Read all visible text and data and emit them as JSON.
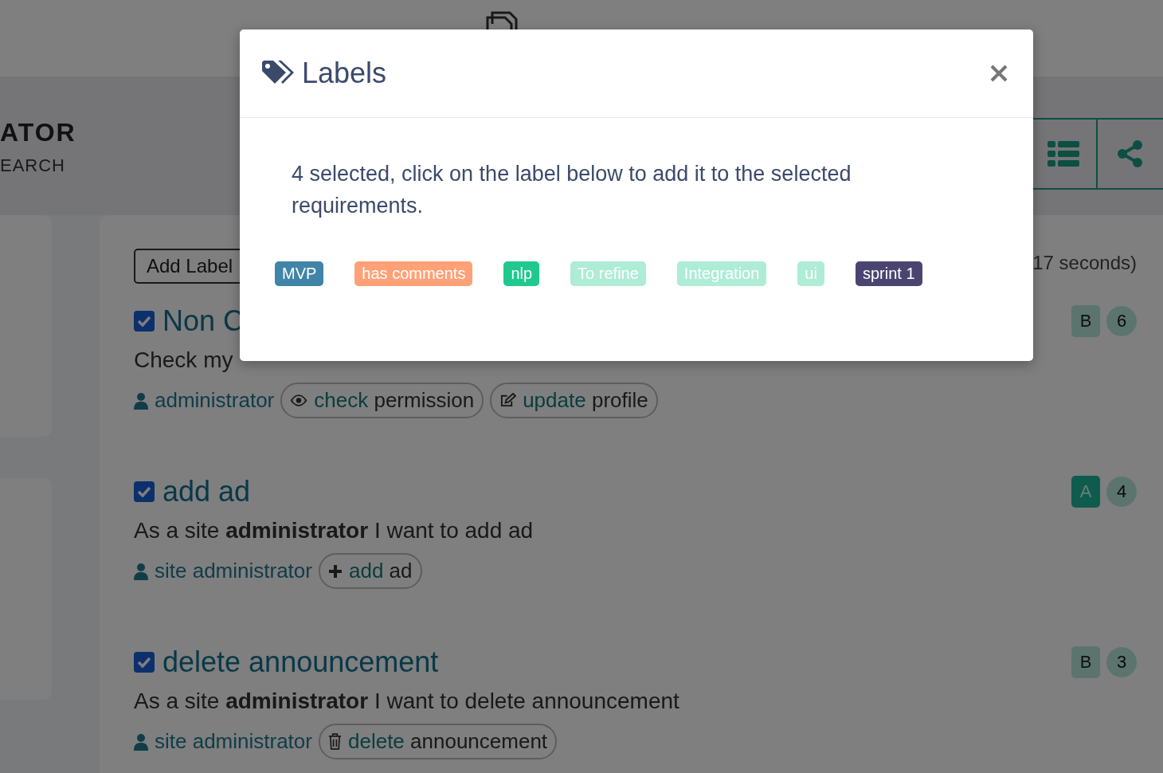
{
  "project": {
    "title": "ATOR",
    "subtitle": "EARCH"
  },
  "toolbar": {
    "add_label": "Add Label",
    "timing": "17 seconds)"
  },
  "requirements": [
    {
      "title": "Non C",
      "checked": true,
      "description": "Check my",
      "actor": "administrator",
      "grade": "B",
      "count": "6",
      "actions": [
        {
          "kind": "view",
          "verb": "check",
          "object": "permission"
        },
        {
          "kind": "edit",
          "verb": "update",
          "object": "profile"
        }
      ]
    },
    {
      "title": "add ad",
      "checked": true,
      "description": "As a site **administrator** I want to add ad",
      "actor": "site administrator",
      "grade": "A",
      "count": "4",
      "actions": [
        {
          "kind": "add",
          "verb": "add",
          "object": "ad"
        }
      ]
    },
    {
      "title": "delete announcement",
      "checked": true,
      "description": "As a site **administrator** I want to delete announcement",
      "actor": "site administrator",
      "grade": "B",
      "count": "3",
      "actions": [
        {
          "kind": "delete",
          "verb": "delete",
          "object": "announcement"
        }
      ]
    }
  ],
  "modal": {
    "title": "Labels",
    "message": "4 selected, click on the label below to add it to the selected requirements.",
    "labels": [
      {
        "text": "MVP",
        "color": "#4084a8"
      },
      {
        "text": "has comments",
        "color": "#ffa177"
      },
      {
        "text": "nlp",
        "color": "#1fc98e"
      },
      {
        "text": "To refine",
        "color": "#aeecd6"
      },
      {
        "text": "Integration",
        "color": "#aeecd6"
      },
      {
        "text": "ui",
        "color": "#aeecd6"
      },
      {
        "text": "sprint 1",
        "color": "#4a4570"
      }
    ]
  }
}
